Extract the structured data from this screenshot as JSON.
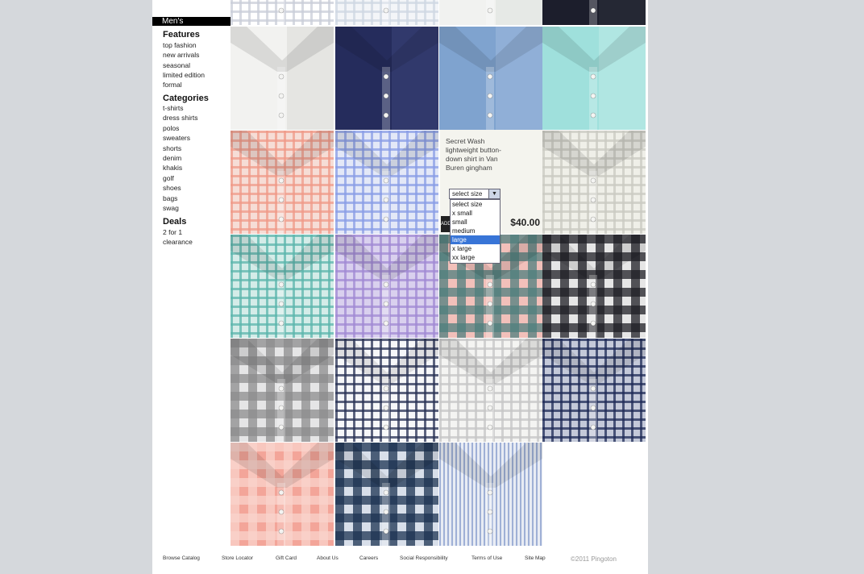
{
  "sidebar": {
    "header": "Men's",
    "features_title": "Features",
    "features": [
      "top fashion",
      "new arrivals",
      "seasonal",
      "limited edition",
      "formal"
    ],
    "categories_title": "Categories",
    "categories": [
      "t-shirts",
      "dress shirts",
      "polos",
      "sweaters",
      "shorts",
      "denim",
      "khakis",
      "golf",
      "shoes",
      "bags",
      "swag"
    ],
    "deals_title": "Deals",
    "deals": [
      "2 for 1",
      "clearance"
    ]
  },
  "detail": {
    "name": "Secret Wash lightweight button-down shirt in Van Buren gingham",
    "size_select": "select size",
    "sizes": [
      "select size",
      "x small",
      "small",
      "medium",
      "large",
      "x large",
      "xx large"
    ],
    "selected_size": "large",
    "price": "$40.00",
    "add_label": "ADD"
  },
  "footer": {
    "links": [
      "Browse Catalog",
      "Store Locator",
      "Gift Card",
      "About Us",
      "Careers",
      "Social Responsibility",
      "Terms of Use",
      "Site Map"
    ],
    "copyright": "©2011 Pingoton"
  },
  "colors": {
    "page_bg": "#d5d8dc",
    "select_highlight": "#3875d7"
  },
  "tiles": [
    {
      "icon": "shirt-check-navy-thumb",
      "base": "#ffffff",
      "lines": "#c9ced8",
      "style": "check"
    },
    {
      "icon": "shirt-check-light-thumb",
      "base": "#f3f5f8",
      "lines": "#cfd7e3",
      "style": "check"
    },
    {
      "icon": "shirt-white-thumb",
      "base": "#f1f2f0",
      "lines": "#e0e2e0",
      "style": "solid"
    },
    {
      "icon": "shirt-dark-thumb",
      "base": "#1c1e2c",
      "lines": "#2c2e3a",
      "style": "solid"
    },
    {
      "icon": "shirt-white-solid",
      "base": "#f2f2f0",
      "lines": "#dcdcd8",
      "style": "solid"
    },
    {
      "icon": "shirt-navy-solid",
      "base": "#252c5c",
      "lines": "#3a4276",
      "style": "solid"
    },
    {
      "icon": "shirt-blue-solid",
      "base": "#7fa3cf",
      "lines": "#9bb8dc",
      "style": "solid"
    },
    {
      "icon": "shirt-aqua-solid",
      "base": "#9fe0dc",
      "lines": "#bdeae6",
      "style": "solid"
    },
    {
      "icon": "shirt-coral-plaid",
      "base": "#f6ddd6",
      "lines": "#ef9a88",
      "style": "check"
    },
    {
      "icon": "shirt-blue-gingham",
      "base": "#e3e8f7",
      "lines": "#8a9de6",
      "style": "check"
    },
    {
      "icon": "shirt-grey-gingham",
      "base": "#efefe8",
      "lines": "#c9c9c2",
      "style": "check"
    },
    {
      "icon": "shirt-teal-gingham",
      "base": "#d4ece8",
      "lines": "#5cb6ac",
      "style": "check"
    },
    {
      "icon": "shirt-lilac-gingham",
      "base": "#d9d0ee",
      "lines": "#a089d3",
      "style": "check"
    },
    {
      "icon": "shirt-red-gingham",
      "base": "#f2c0ba",
      "lines": "#4f7f7e",
      "style": "bigcheck"
    },
    {
      "icon": "shirt-black-gingham",
      "base": "#e6e6e6",
      "lines": "#1f1f26",
      "style": "bigcheck"
    },
    {
      "icon": "shirt-grey-bigcheck",
      "base": "#e5e5e6",
      "lines": "#8c8c8e",
      "style": "bigcheck"
    },
    {
      "icon": "shirt-navy-windowpane",
      "base": "#f6f7f9",
      "lines": "#283154",
      "style": "check"
    },
    {
      "icon": "shirt-light-grey-check",
      "base": "#f4f4f2",
      "lines": "#c6c6c6",
      "style": "check"
    },
    {
      "icon": "shirt-navy-microcheck",
      "base": "#c4c9d9",
      "lines": "#1e2a55",
      "style": "check"
    },
    {
      "icon": "shirt-salmon-check",
      "base": "#f3a599",
      "lines": "#f9d3cb",
      "style": "bigcheck"
    },
    {
      "icon": "shirt-blue-tartan",
      "base": "#d8dfea",
      "lines": "#1c3352",
      "style": "bigcheck"
    },
    {
      "icon": "shirt-blue-stripe",
      "base": "#e8ecf4",
      "lines": "#9fb0d6",
      "style": "stripe"
    },
    {
      "icon": "shirt-pale-blue",
      "base": "#e9eff8",
      "lines": "#d4deee",
      "style": "solid"
    }
  ]
}
